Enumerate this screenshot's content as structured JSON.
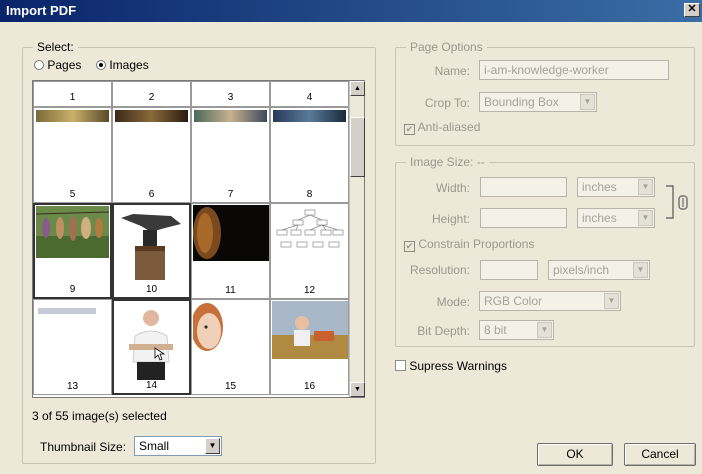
{
  "window": {
    "title": "Import PDF",
    "close_glyph": "✕"
  },
  "select": {
    "legend": "Select:",
    "pages_label": "Pages",
    "images_label": "Images",
    "selected_mode": "images"
  },
  "thumbnails": {
    "row_labels": [
      [
        "1",
        "2",
        "3",
        "4"
      ],
      [
        "5",
        "6",
        "7",
        "8"
      ],
      [
        "9",
        "10",
        "11",
        "12"
      ],
      [
        "13",
        "14",
        "15",
        "16"
      ]
    ],
    "selected": [
      "9",
      "10",
      "14"
    ]
  },
  "selection_status": "3 of 55 image(s) selected",
  "thumbnail_size": {
    "label": "Thumbnail Size:",
    "value": "Small"
  },
  "page_options": {
    "legend": "Page Options",
    "name_label": "Name:",
    "name_value": "i-am-knowledge-worker",
    "crop_label": "Crop To:",
    "crop_value": "Bounding Box",
    "anti_aliased_label": "Anti-aliased",
    "anti_aliased": true
  },
  "image_size": {
    "legend": "Image Size: --",
    "width_label": "Width:",
    "width_value": "",
    "width_unit": "inches",
    "height_label": "Height:",
    "height_value": "",
    "height_unit": "inches",
    "constrain_label": "Constrain Proportions",
    "constrain": true,
    "resolution_label": "Resolution:",
    "resolution_value": "",
    "resolution_unit": "pixels/inch",
    "mode_label": "Mode:",
    "mode_value": "RGB Color",
    "bitdepth_label": "Bit Depth:",
    "bitdepth_value": "8 bit"
  },
  "suppress_warnings_label": "Supress Warnings",
  "buttons": {
    "ok": "OK",
    "cancel": "Cancel"
  },
  "icons": {
    "link": "chain-link-icon",
    "check": "✔"
  }
}
